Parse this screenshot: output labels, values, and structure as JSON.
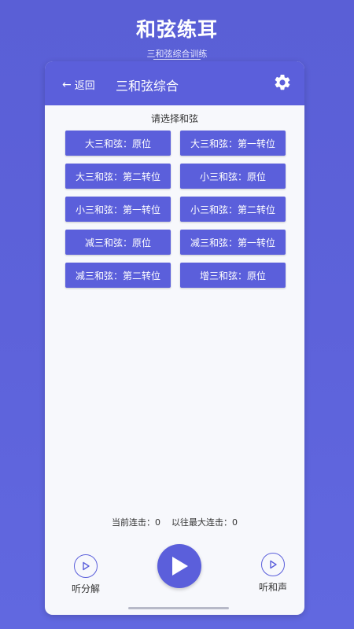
{
  "banner": {
    "title": "和弦练耳",
    "subtitle": "三和弦综合训练"
  },
  "appbar": {
    "back_label": "返回",
    "back_arrow": "←",
    "title": "三和弦综合",
    "settings_icon": "gear-icon"
  },
  "section_title": "请选择和弦",
  "chords": [
    {
      "label": "大三和弦：原位"
    },
    {
      "label": "大三和弦：第一转位"
    },
    {
      "label": "大三和弦：第二转位"
    },
    {
      "label": "小三和弦：原位"
    },
    {
      "label": "小三和弦：第一转位"
    },
    {
      "label": "小三和弦：第二转位"
    },
    {
      "label": "减三和弦：原位"
    },
    {
      "label": "减三和弦：第一转位"
    },
    {
      "label": "减三和弦：第二转位"
    },
    {
      "label": "增三和弦：原位"
    }
  ],
  "streak": {
    "current": "当前连击：0",
    "best": "以往最大连击：0"
  },
  "controls": {
    "left_label": "听分解",
    "right_label": "听和声",
    "play_icon": "play-icon"
  },
  "colors": {
    "accent": "#5b5fdb",
    "background": "#5d62da",
    "card": "#f7f8fc"
  }
}
